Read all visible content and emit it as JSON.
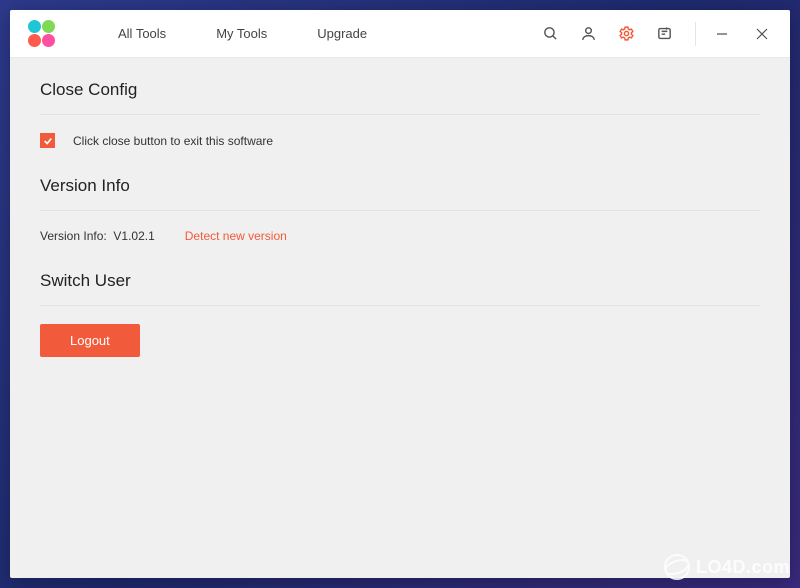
{
  "nav": {
    "tabs": [
      "All Tools",
      "My Tools",
      "Upgrade"
    ]
  },
  "sections": {
    "close_config": {
      "title": "Close Config",
      "checkbox_label": "Click close button to exit this software"
    },
    "version_info": {
      "title": "Version Info",
      "label": "Version Info:",
      "value": "V1.02.1",
      "detect_link": "Detect new version"
    },
    "switch_user": {
      "title": "Switch User",
      "logout_button": "Logout"
    }
  },
  "watermark": "LO4D.com"
}
